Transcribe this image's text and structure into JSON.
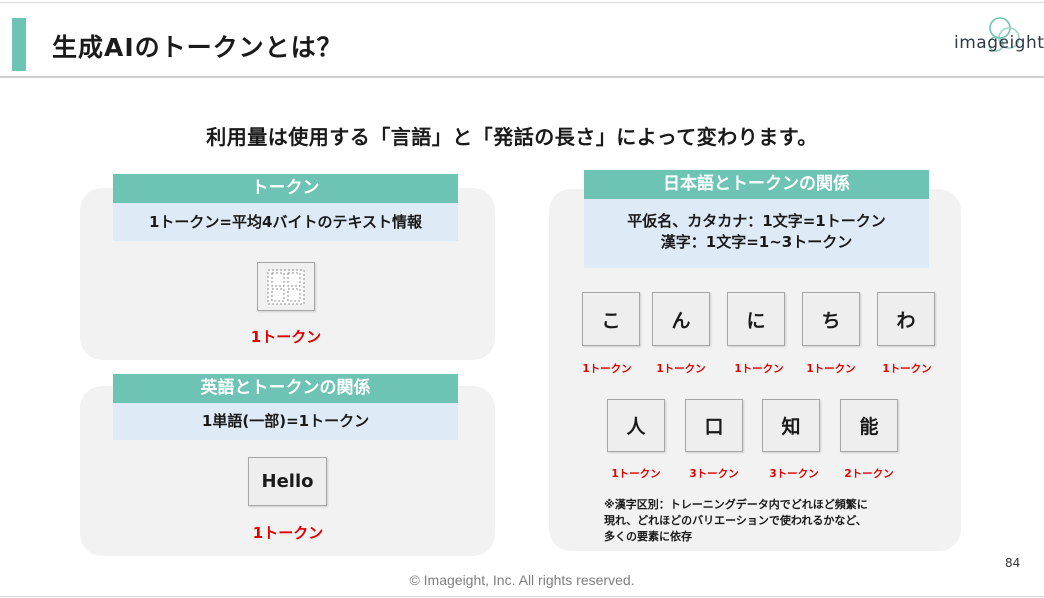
{
  "header": {
    "title": "生成AIのトークンとは？",
    "logo_text": "imageight"
  },
  "subtitle": "利用量は使用する「言語」と「発話の長さ」によって変わります。",
  "token_panel": {
    "header": "トークン",
    "description": "1トークン=平均4バイトのテキスト情報",
    "token_label": "1トークン"
  },
  "english_panel": {
    "header": "英語とトークンの関係",
    "description": "1単語(一部)=1トークン",
    "example_word": "Hello",
    "token_label": "1トークン"
  },
  "japanese_panel": {
    "header": "日本語とトークンの関係",
    "description_line1": "平仮名、カタカナ：1文字=1トークン",
    "description_line2": "漢字：1文字=1~3トークン",
    "hiragana": [
      {
        "char": "こ",
        "tokens": "1トークン"
      },
      {
        "char": "ん",
        "tokens": "1トークン"
      },
      {
        "char": "に",
        "tokens": "1トークン"
      },
      {
        "char": "ち",
        "tokens": "1トークン"
      },
      {
        "char": "わ",
        "tokens": "1トークン"
      }
    ],
    "kanji": [
      {
        "char": "人",
        "tokens": "1トークン"
      },
      {
        "char": "口",
        "tokens": "3トークン"
      },
      {
        "char": "知",
        "tokens": "3トークン"
      },
      {
        "char": "能",
        "tokens": "2トークン"
      }
    ],
    "note_line1": "※漢字区別：トレーニングデータ内でどれほど頻繁に",
    "note_line2": "現れ、どれほどのバリエーションで使われるかなど、",
    "note_line3": "多くの要素に依存"
  },
  "page_number": "84",
  "footer": "© Imageight, Inc. All rights reserved.",
  "colors": {
    "accent": "#6ec4b4",
    "description_bg": "#deebf7",
    "panel_bg": "#f2f2f2",
    "token_red": "#e00000"
  }
}
